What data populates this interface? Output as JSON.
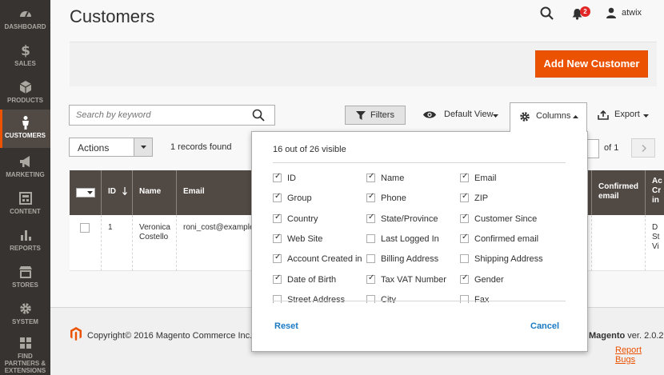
{
  "sidebar": {
    "items": [
      {
        "label": "DASHBOARD",
        "icon": "dashboard-icon",
        "active": false
      },
      {
        "label": "SALES",
        "icon": "dollar-icon",
        "active": false
      },
      {
        "label": "PRODUCTS",
        "icon": "cube-icon",
        "active": false
      },
      {
        "label": "CUSTOMERS",
        "icon": "person-icon",
        "active": true
      },
      {
        "label": "MARKETING",
        "icon": "megaphone-icon",
        "active": false
      },
      {
        "label": "CONTENT",
        "icon": "content-icon",
        "active": false
      },
      {
        "label": "REPORTS",
        "icon": "bar-chart-icon",
        "active": false
      },
      {
        "label": "STORES",
        "icon": "store-icon",
        "active": false
      },
      {
        "label": "SYSTEM",
        "icon": "gear-icon",
        "active": false
      },
      {
        "label": "FIND PARTNERS & EXTENSIONS",
        "icon": "extensions-icon",
        "active": false
      }
    ]
  },
  "header": {
    "title": "Customers",
    "notifications_count": "2",
    "user_name": "atwix"
  },
  "action_bar": {
    "add_button": "Add New Customer"
  },
  "grid": {
    "search_placeholder": "Search by keyword",
    "filters_label": "Filters",
    "view_label": "Default View",
    "columns_label": "Columns",
    "export_label": "Export",
    "actions_label": "Actions",
    "records_found": "1 records found",
    "pages_label": "of 1",
    "headers": {
      "id": "ID",
      "name": "Name",
      "email": "Email",
      "confirmed_email": "Confirmed email",
      "account_created_in": "Ac\nCr\nin"
    },
    "row": {
      "id": "1",
      "name_line1": "Veronica",
      "name_line2": "Costello",
      "email": "roni_cost@example",
      "last_col_line1": "D",
      "last_col_line2": "St",
      "last_col_line3": "Vi"
    }
  },
  "columns_panel": {
    "visible_text": "16 out of 26 visible",
    "options": [
      {
        "label": "ID",
        "checked": true
      },
      {
        "label": "Name",
        "checked": true
      },
      {
        "label": "Email",
        "checked": true
      },
      {
        "label": "Group",
        "checked": true
      },
      {
        "label": "Phone",
        "checked": true
      },
      {
        "label": "ZIP",
        "checked": true
      },
      {
        "label": "Country",
        "checked": true
      },
      {
        "label": "State/Province",
        "checked": true
      },
      {
        "label": "Customer Since",
        "checked": true
      },
      {
        "label": "Web Site",
        "checked": true
      },
      {
        "label": "Last Logged In",
        "checked": false
      },
      {
        "label": "Confirmed email",
        "checked": true
      },
      {
        "label": "Account Created in",
        "checked": true
      },
      {
        "label": "Billing Address",
        "checked": false
      },
      {
        "label": "Shipping Address",
        "checked": false
      },
      {
        "label": "Date of Birth",
        "checked": true
      },
      {
        "label": "Tax VAT Number",
        "checked": true
      },
      {
        "label": "Gender",
        "checked": true
      },
      {
        "label": "Street Address",
        "checked": false
      },
      {
        "label": "City",
        "checked": false
      },
      {
        "label": "Fax",
        "checked": false
      }
    ],
    "reset_label": "Reset",
    "cancel_label": "Cancel"
  },
  "footer": {
    "copyright": "Copyright© 2016 Magento Commerce Inc.",
    "brand": "Magento",
    "version": "ver. 2.0.2",
    "report_bugs": "Report Bugs"
  },
  "colors": {
    "accent": "#eb5202",
    "sidebar_bg": "#373330",
    "table_header_bg": "#514943",
    "link": "#1979c3"
  }
}
